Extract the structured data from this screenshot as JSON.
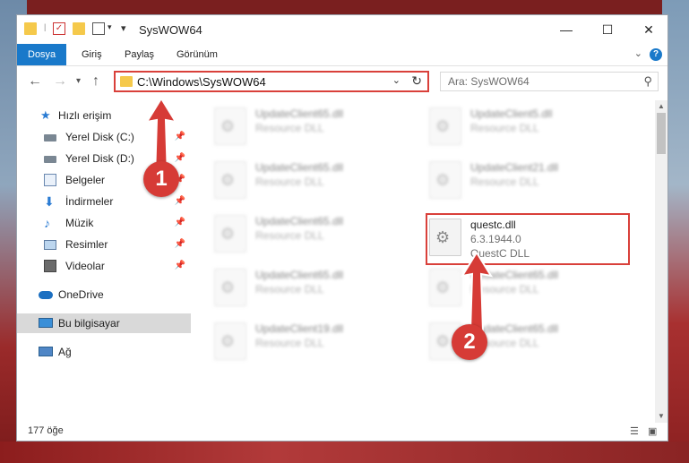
{
  "window": {
    "title": "SysWOW64",
    "controls": {
      "minimize": "—",
      "maximize": "☐",
      "close": "✕"
    }
  },
  "ribbon": {
    "tabs": [
      "Dosya",
      "Giriş",
      "Paylaş",
      "Görünüm"
    ],
    "help": "?"
  },
  "address_bar": {
    "path": "C:\\Windows\\SysWOW64"
  },
  "search": {
    "placeholder": "Ara: SysWOW64"
  },
  "sidebar": {
    "items": [
      {
        "label": "Hızlı erişim",
        "icon": "star-icon"
      },
      {
        "label": "Yerel Disk (C:)",
        "icon": "drive-icon",
        "pinned": true
      },
      {
        "label": "Yerel Disk (D:)",
        "icon": "drive-icon",
        "pinned": true
      },
      {
        "label": "Belgeler",
        "icon": "documents-icon",
        "pinned": true
      },
      {
        "label": "İndirmeler",
        "icon": "download-icon",
        "pinned": true
      },
      {
        "label": "Müzik",
        "icon": "music-icon",
        "pinned": true
      },
      {
        "label": "Resimler",
        "icon": "pictures-icon",
        "pinned": true
      },
      {
        "label": "Videolar",
        "icon": "videos-icon",
        "pinned": true
      },
      {
        "label": "OneDrive",
        "icon": "cloud-icon"
      },
      {
        "label": "Bu bilgisayar",
        "icon": "computer-icon",
        "selected": true
      },
      {
        "label": "Ağ",
        "icon": "network-icon"
      }
    ]
  },
  "files": [
    {
      "name": "UpdateClient65.dll",
      "type": "Resource DLL"
    },
    {
      "name": "UpdateClient5.dll",
      "type": "Resource DLL"
    },
    {
      "name": "UpdateClient65.dll",
      "type": "Resource DLL"
    },
    {
      "name": "UpdateClient21.dll",
      "type": "Resource DLL"
    },
    {
      "name": "UpdateClient65.dll",
      "type": "Resource DLL"
    },
    {
      "name": "questc.dll",
      "version": "6.3.1944.0",
      "type": "QuestC DLL"
    },
    {
      "name": "UpdateClient65.dll",
      "type": "Resource DLL"
    },
    {
      "name": "UpdateClient65.dll",
      "type": "Resource DLL"
    },
    {
      "name": "UpdateClient19.dll",
      "type": "Resource DLL"
    },
    {
      "name": "UpdateClient65.dll",
      "type": "Resource DLL"
    }
  ],
  "status": {
    "count": "177 öğe"
  },
  "markers": {
    "one": "1",
    "two": "2"
  },
  "colors": {
    "accent": "#1979ca",
    "highlight": "#d9403a"
  }
}
